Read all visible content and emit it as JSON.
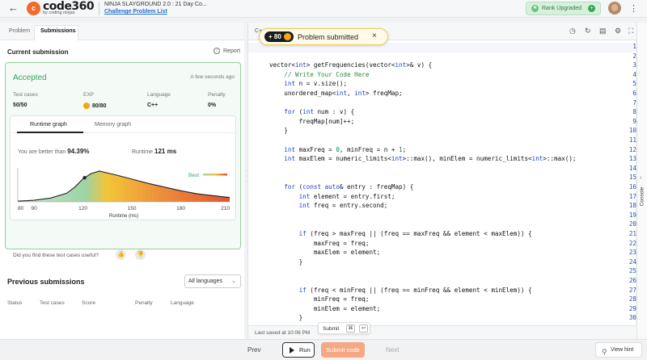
{
  "header": {
    "back_icon": "arrow-left-icon",
    "logo_mark": "c",
    "logo_text": "code360",
    "logo_sub": "by coding ninjas",
    "event_title": "NINJA SLAYGROUND 2.0 : 21 Day Co...",
    "event_link": "Challenge Problem List",
    "rank_badge": "Rank Upgraded",
    "rank_plus": "+",
    "menu_icon": "more-vertical-icon"
  },
  "left": {
    "tabs": [
      "Problem",
      "Submissions"
    ],
    "current_submission": "Current submission",
    "report": "Report",
    "report_icon": "i",
    "status": "Accepted",
    "time_ago": "A few seconds ago",
    "stats": [
      {
        "label": "Test cases",
        "value": "50/50"
      },
      {
        "label": "EXP",
        "value": "80/80"
      },
      {
        "label": "Language",
        "value": "C++"
      },
      {
        "label": "Penalty",
        "value": "0%"
      }
    ],
    "graph_tabs": [
      "Runtime graph",
      "Memory graph"
    ],
    "better_prefix": "You are better than",
    "better_value": "94.39%",
    "runtime_prefix": "Runtime",
    "runtime_value": "121 ms",
    "useful_question": "Did you find these test cases useful?",
    "thumb_up": "👍",
    "thumb_down": "👎",
    "previous_title": "Previous submissions",
    "language_filter": "All languages",
    "columns": [
      "Status",
      "Test cases",
      "Score",
      "Penalty",
      "Language"
    ]
  },
  "chart_data": {
    "type": "area",
    "x": [
      80,
      90,
      100,
      110,
      115,
      120,
      125,
      130,
      140,
      150,
      160,
      170,
      180,
      190,
      200,
      210
    ],
    "y": [
      0.02,
      0.05,
      0.12,
      0.28,
      0.48,
      0.75,
      0.92,
      1.0,
      0.88,
      0.74,
      0.6,
      0.48,
      0.36,
      0.26,
      0.2,
      0.14
    ],
    "x_ticks": [
      80,
      90,
      120,
      150,
      180,
      210
    ],
    "xlabel": "Runtime (ms)",
    "legend_label": "Best",
    "marker_x": 121,
    "xlim": [
      80,
      210
    ],
    "colors": {
      "left": "#9ed3a6",
      "peak": "#f3c53a",
      "right": "#e2522f"
    }
  },
  "editor": {
    "language_fragment": "C+",
    "toast_points": "+ 80",
    "toast_message": "Problem submitted",
    "toast_close": "×",
    "tool_icons": [
      "timer-icon",
      "refresh-icon",
      "layout-icon",
      "settings-icon",
      "expand-icon"
    ],
    "code_lines": [
      "",
      "",
      "vector<int> getFrequencies(vector<int>& v) {",
      "    // Write Your Code Here",
      "    int n = v.size();",
      "    unordered_map<int, int> freqMap;",
      "",
      "    for (int num : v) {",
      "        freqMap[num]++;",
      "    }",
      "",
      "    int maxFreq = 0, minFreq = n + 1;",
      "    int maxElem = numeric_limits<int>::max(), minElem = numeric_limits<int>::max();",
      "",
      "",
      "    for (const auto& entry : freqMap) {",
      "        int element = entry.first;",
      "        int freq = entry.second;",
      "",
      "",
      "        if (freq > maxFreq || (freq == maxFreq && element < maxElem)) {",
      "            maxFreq = freq;",
      "            maxElem = element;",
      "        }",
      "",
      "",
      "        if (freq < minFreq || (freq == minFreq && element < minElem)) {",
      "            minFreq = freq;",
      "            minElem = element;",
      "        }"
    ],
    "saved_text": "Last saved at 10:06 PM",
    "submit_hint": "Submit",
    "hint_keys": [
      "⌘",
      "↩"
    ]
  },
  "console": {
    "label": "Console",
    "chevron": "‹"
  },
  "footer": {
    "prev": "Prev",
    "run": "Run",
    "submit": "Submit code",
    "next": "Next",
    "view_hint": "View hint"
  }
}
